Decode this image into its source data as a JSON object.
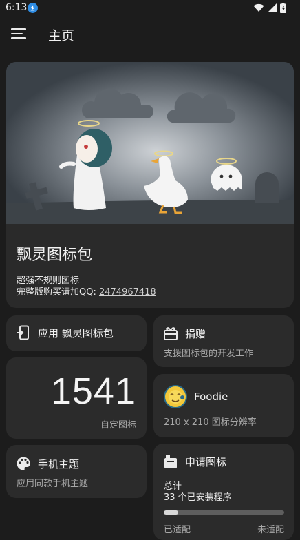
{
  "status_bar": {
    "time": "6:13",
    "download_icon": "download-icon",
    "icons": [
      "wifi-icon",
      "signal-icon",
      "battery-icon"
    ]
  },
  "app_bar": {
    "title": "主页",
    "menu_icon": "menu-icon"
  },
  "hero": {
    "title": "飘灵图标包",
    "description": "超强不规则图标",
    "qq_prefix": "完整版购买请加QQ: ",
    "qq_number": "2474967418"
  },
  "apply_card": {
    "icon": "phone-apply-icon",
    "label": "应用 飘灵图标包"
  },
  "donate_card": {
    "icon": "gift-icon",
    "title": "捐赠",
    "subtitle": "支援图标包的开发工作"
  },
  "count_card": {
    "number": "1541",
    "label": "自定图标"
  },
  "foodie_card": {
    "icon": "foodie-icon",
    "title": "Foodie",
    "subtitle": "210 x 210 图标分辨率"
  },
  "theme_card": {
    "icon": "palette-icon",
    "title": "手机主题",
    "subtitle": "应用同款手机主题"
  },
  "request_card": {
    "icon": "request-icon",
    "title": "申请图标",
    "total_label": "总计",
    "installed": "33 个已安装程序",
    "progress": 0.12,
    "adapted_label": "已适配",
    "not_adapted_label": "未适配"
  },
  "colors": {
    "background": "#1c1c1c",
    "card": "#2b2b2b",
    "download_badge": "#2f8de4"
  }
}
